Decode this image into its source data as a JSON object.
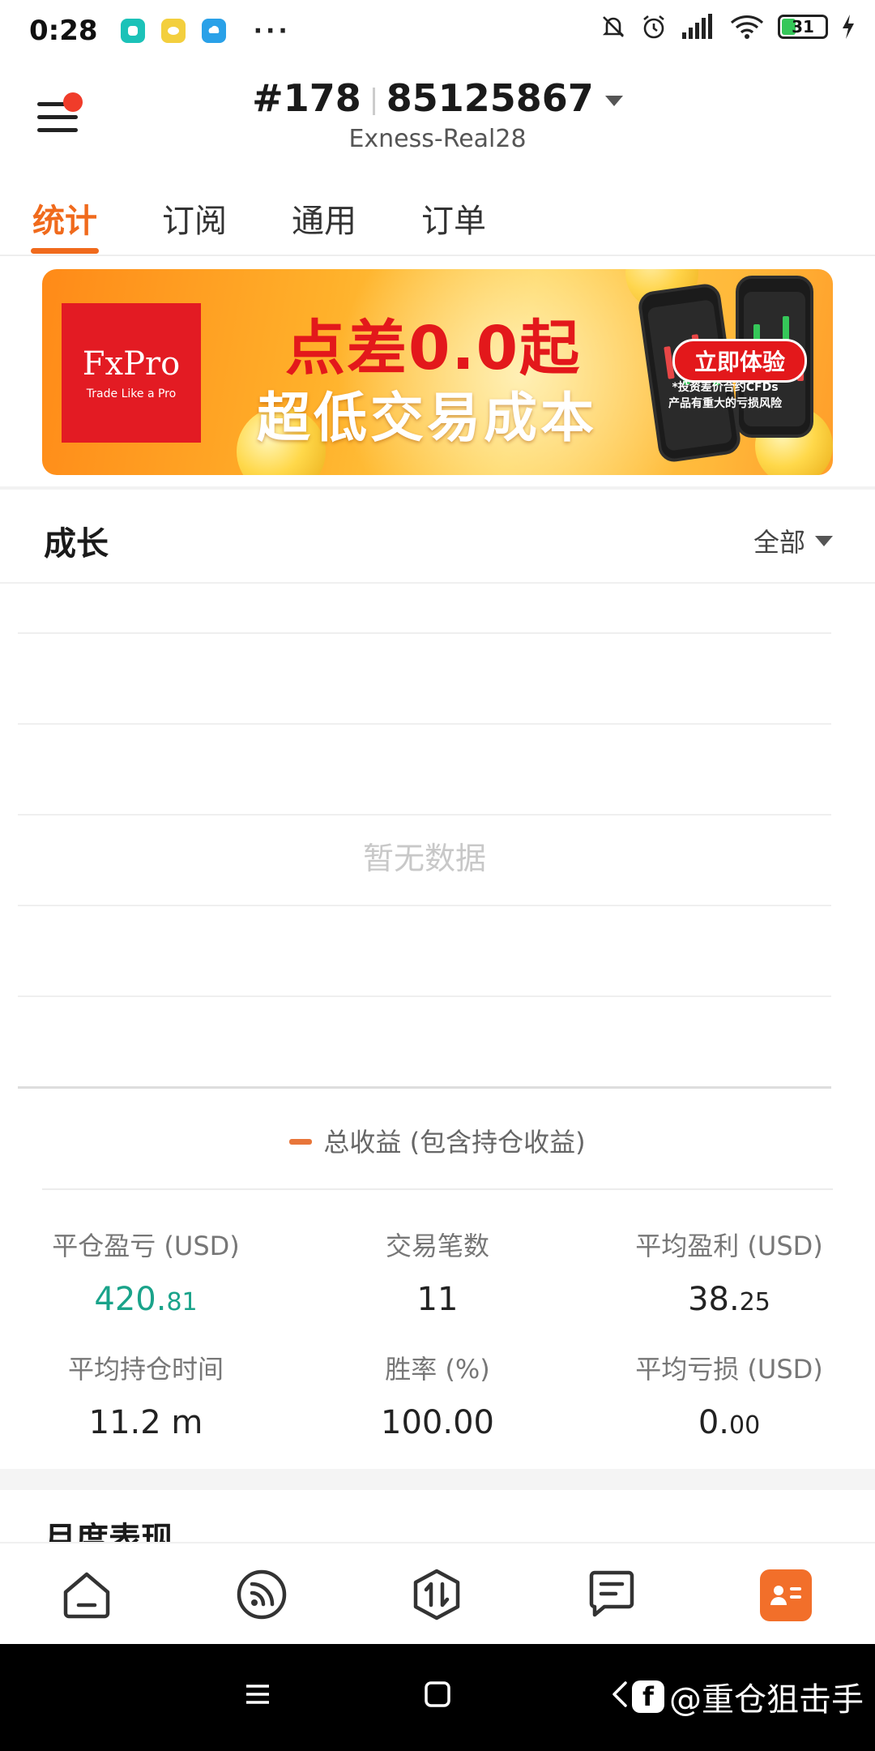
{
  "status_bar": {
    "time": "0:28",
    "more": "···",
    "battery": "31",
    "icons": [
      "app-icon-teal",
      "app-icon-yellow",
      "app-icon-blue",
      "mute-icon",
      "alarm-icon",
      "signal-icon",
      "wifi-icon",
      "battery-icon",
      "charging-icon"
    ]
  },
  "header": {
    "account_prefix": "#178",
    "account_number": "85125867",
    "server": "Exness-Real28"
  },
  "tabs": [
    {
      "label": "统计",
      "active": true
    },
    {
      "label": "订阅",
      "active": false
    },
    {
      "label": "通用",
      "active": false
    },
    {
      "label": "订单",
      "active": false
    }
  ],
  "banner": {
    "logo_name": "FxPro",
    "logo_tagline": "Trade Like a Pro",
    "headline": "点差0.0起",
    "subheadline": "超低交易成本",
    "cta": "立即体验",
    "risk_line1": "*投资差价合约CFDs",
    "risk_line2": "产品有重大的亏损风险"
  },
  "growth": {
    "title": "成长",
    "filter": "全部",
    "empty": "暂无数据",
    "legend": "总收益 (包含持仓收益)"
  },
  "stats": [
    {
      "label": "平仓盈亏 (USD)",
      "int": "420.",
      "dec": "81",
      "color": "#1aa38a"
    },
    {
      "label": "交易笔数",
      "int": "11",
      "dec": ""
    },
    {
      "label": "平均盈利 (USD)",
      "int": "38.",
      "dec": "25"
    },
    {
      "label": "平均持仓时间",
      "int": "11.2 m",
      "dec": ""
    },
    {
      "label": "胜率 (%)",
      "int": "100.00",
      "dec": ""
    },
    {
      "label": "平均亏损 (USD)",
      "int": "0.",
      "dec": "00"
    }
  ],
  "monthly": {
    "title": "月度表现"
  },
  "bottom_nav": [
    "home-icon",
    "feed-icon",
    "trade-icon",
    "messages-icon",
    "profile-card-icon"
  ],
  "watermark": {
    "badge": "f",
    "text": "@重仓狙击手"
  },
  "colors": {
    "accent": "#f06a1c",
    "profit": "#1aa38a",
    "brand_red": "#e31b23"
  }
}
